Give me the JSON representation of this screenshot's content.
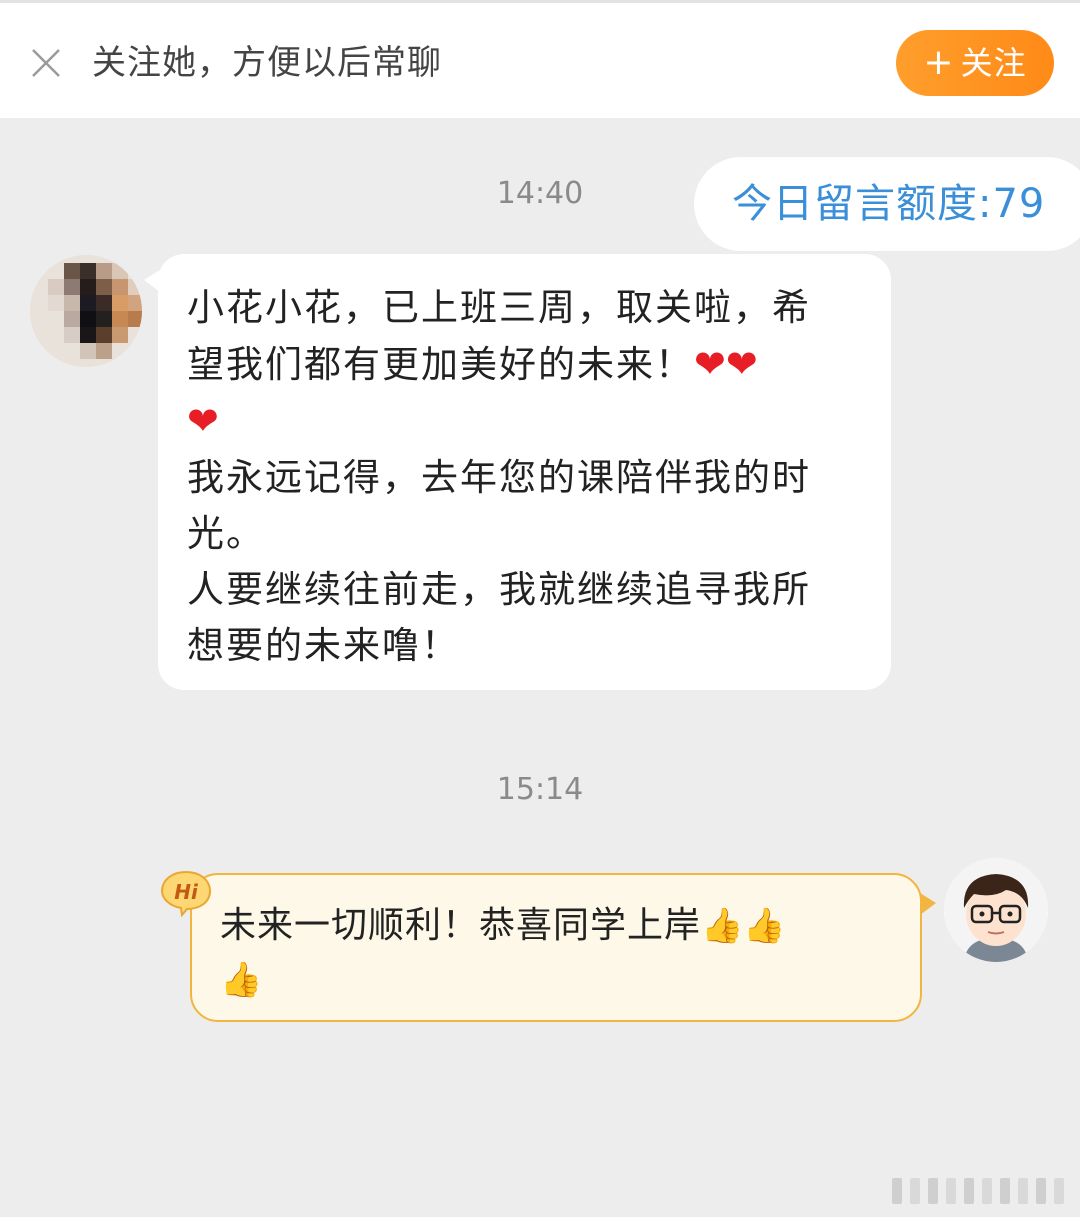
{
  "topbar": {
    "prompt_text": "关注她，方便以后常聊",
    "follow_plus": "+",
    "follow_label": "关注"
  },
  "conversation": {
    "quota_label": "今日留言额度:79",
    "timestamps": [
      "14:40",
      "15:14"
    ],
    "incoming_message": {
      "lines": [
        "小花小花，已上班三周，取关啦，希",
        "望我们都有更加美好的未来！",
        "",
        "我永远记得，去年您的课陪伴我的时",
        "光。",
        "人要继续往前走，我就继续追寻我所",
        "想要的未来噜！"
      ],
      "emoji": "❤"
    },
    "outgoing_message": {
      "lines": [
        "未来一切顺利！恭喜同学上岸",
        ""
      ],
      "emoji": "👍",
      "badge_text": "Hi"
    }
  },
  "colors": {
    "accent_orange": "#ff9420",
    "quota_blue": "#3a8fd8",
    "heart_red": "#e81e26",
    "outgoing_border": "#f2b53f"
  }
}
